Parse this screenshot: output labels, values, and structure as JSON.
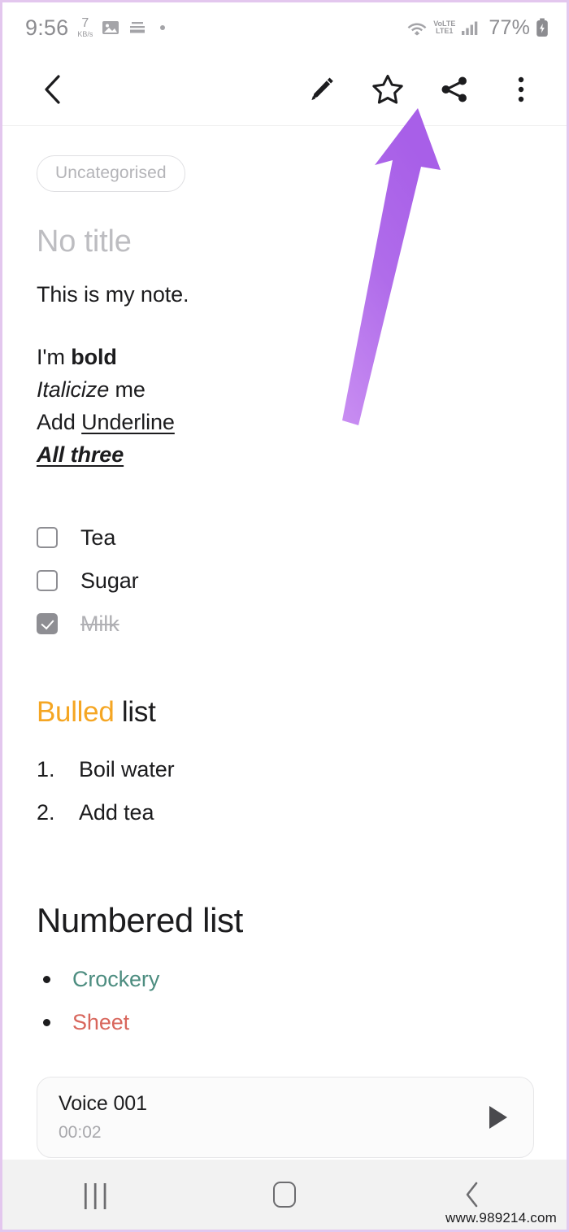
{
  "status_bar": {
    "time": "9:56",
    "net_speed_value": "7",
    "net_speed_unit": "KB/s",
    "icons": [
      "image-icon",
      "playlist-icon",
      "dot-icon",
      "wifi-icon",
      "signal-icon",
      "battery-icon"
    ],
    "volte_top": "VoLTE",
    "volte_bottom": "LTE1",
    "battery_percent": "77%"
  },
  "toolbar": {
    "back_label": "Back",
    "edit_label": "Edit",
    "favorite_label": "Add to favourites",
    "share_label": "Share",
    "more_label": "More options"
  },
  "note": {
    "category_chip": "Uncategorised",
    "title_placeholder": "No title",
    "paragraph": "This is my note.",
    "format_lines": [
      {
        "prefix": "I'm ",
        "bold": "bold"
      },
      {
        "italic": "Italicize",
        "suffix": " me"
      },
      {
        "prefix": "Add ",
        "underline": "Underline "
      },
      {
        "all_three": "All three"
      }
    ],
    "checklist": [
      {
        "label": "Tea",
        "checked": false
      },
      {
        "label": "Sugar",
        "checked": false
      },
      {
        "label": "Milk",
        "checked": true
      }
    ],
    "orange_heading": {
      "colored": "Bulled",
      "plain": " list"
    },
    "ordered_list": [
      {
        "num": "1.",
        "text": "Boil water"
      },
      {
        "num": "2.",
        "text": "Add tea"
      }
    ],
    "big_heading": "Numbered list",
    "bulleted_list": [
      {
        "text": "Crockery",
        "color": "#4d8d80"
      },
      {
        "text": "Sheet",
        "color": "#d8665c"
      }
    ],
    "voice": {
      "name": "Voice 001",
      "duration": "00:02",
      "play_label": "Play"
    }
  },
  "nav_bar": {
    "recents_label": "Recents",
    "home_label": "Home",
    "back_label": "Back"
  },
  "watermark": "www.989214.com",
  "colors": {
    "accent_orange": "#f5a623",
    "teal": "#4d8d80",
    "salmon": "#d8665c",
    "annotation_purple": "#b06cea",
    "attachment_beige": "#f0e7dd"
  }
}
